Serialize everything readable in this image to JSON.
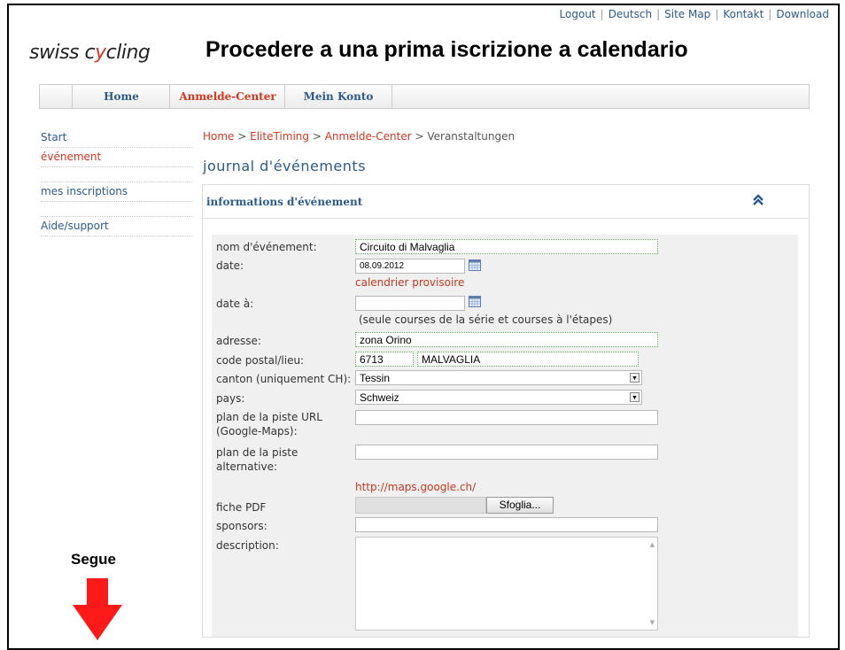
{
  "top_links": [
    "Logout",
    "Deutsch",
    "Site Map",
    "Kontakt",
    "Download"
  ],
  "logo": {
    "text_before": "swiss c",
    "text_red": "y",
    "text_after": "cling"
  },
  "title": "Procedere a una prima iscrizione a calendario",
  "nav": {
    "home": "Home",
    "anmelde": "Anmelde-Center",
    "konto": "Mein Konto"
  },
  "sidebar": {
    "start": "Start",
    "evenement": "événement",
    "inscriptions": "mes inscriptions",
    "aide": "Aide/support"
  },
  "breadcrumb": {
    "home": "Home",
    "elite": "EliteTiming",
    "anmelde": "Anmelde-Center",
    "current": "Veranstaltungen",
    "sep": " > "
  },
  "page_title": "journal d'événements",
  "panel_title": "informations d'événement",
  "form": {
    "nom_label": "nom d'événement:",
    "nom_value": "Circuito di Malvaglia",
    "date_label": "date:",
    "date_value": "08.09.2012",
    "date_hint": "calendrier provisoire",
    "date_a_label": "date à:",
    "date_a_value": "",
    "date_a_hint": "(seule courses de la série et courses à l'étapes)",
    "adresse_label": "adresse:",
    "adresse_value": "zona Orino",
    "cp_label": "code postal/lieu:",
    "cp_value": "6713",
    "lieu_value": "MALVAGLIA",
    "canton_label": "canton (uniquement CH):",
    "canton_value": "Tessin",
    "pays_label": "pays:",
    "pays_value": "Schweiz",
    "plan_url_label_1": "plan de la piste URL",
    "plan_url_label_2": "(Google-Maps):",
    "plan_alt_label_1": "plan de la piste",
    "plan_alt_label_2": "alternative:",
    "maps_link": "http://maps.google.ch/",
    "pdf_label": "fiche PDF",
    "browse_label": "Sfoglia...",
    "sponsors_label": "sponsors:",
    "description_label": "description:"
  },
  "annotation": {
    "segue": "Segue"
  },
  "colors": {
    "accent_red": "#d6361e",
    "link_blue": "#2a5b8c"
  }
}
